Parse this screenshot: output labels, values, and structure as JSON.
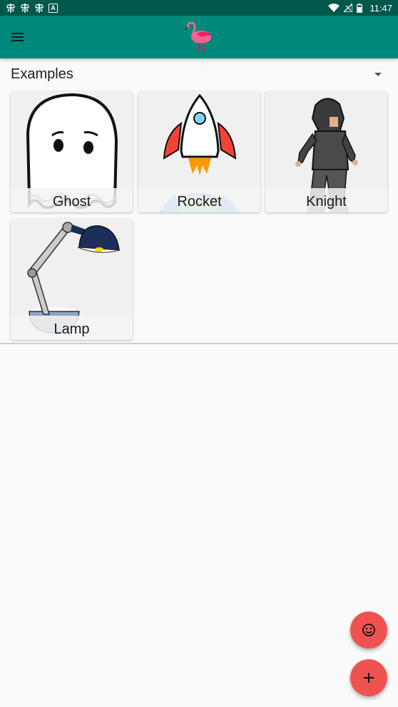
{
  "status_bar": {
    "left_icons": [
      "bug-icon",
      "bug-icon",
      "bug-icon",
      "a-icon"
    ],
    "right_icons": [
      "wifi-icon",
      "signal-icon",
      "battery-icon"
    ],
    "time": "11:47"
  },
  "app_bar": {
    "menu_icon": "menu-icon",
    "logo_icon": "flamingo-icon",
    "color": "#00897b"
  },
  "section": {
    "title": "Examples",
    "dropdown_icon": "dropdown-icon"
  },
  "examples": [
    {
      "label": "Ghost"
    },
    {
      "label": "Rocket"
    },
    {
      "label": "Knight"
    },
    {
      "label": "Lamp"
    }
  ],
  "fabs": {
    "emoji_icon": "smiley-icon",
    "add_icon": "plus-icon",
    "color": "#ef5350"
  }
}
